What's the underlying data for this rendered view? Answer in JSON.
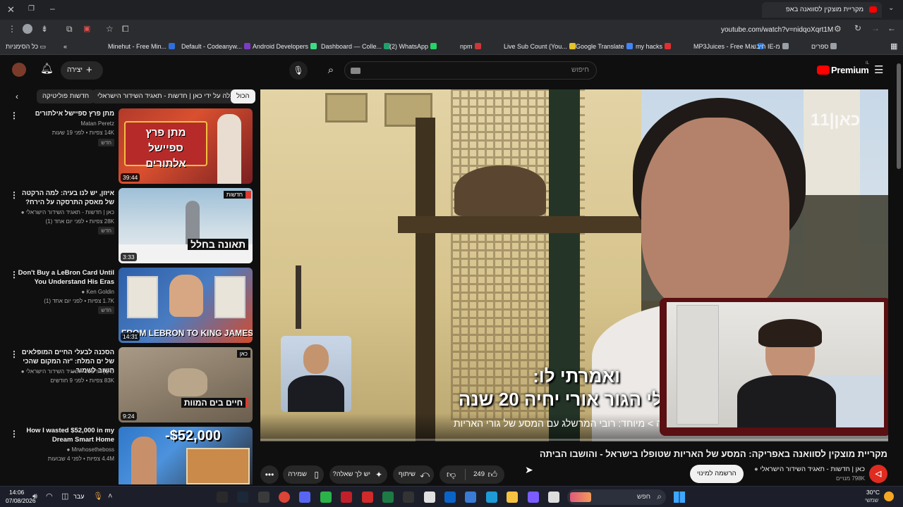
{
  "browser": {
    "tab_title": "מקריית מוצקין לסוואנה באפ",
    "url": "youtube.com/watch?v=nidqoXqrt1M",
    "bookmarks": [
      {
        "label": "Minehut - Free Min...",
        "color": "#2f6fdc"
      },
      {
        "label": "Default - Codeanyw...",
        "color": "#7a3cc4"
      },
      {
        "label": "Android Developers",
        "color": "#3ddc84"
      },
      {
        "label": "Dashboard — Colle...",
        "color": "#22a06b"
      },
      {
        "label": "(2) WhatsApp",
        "color": "#25d366"
      },
      {
        "label": "npm",
        "color": "#cb3837"
      },
      {
        "label": "Live Sub Count (You...",
        "color": "#e5c22b"
      },
      {
        "label": "Google Translate",
        "color": "#4285f4"
      },
      {
        "label": "my hacks",
        "color": "#e03030"
      },
      {
        "label": "MP3Juices - Free M...",
        "color": "#1e6fd9"
      },
      {
        "label": "חיבוא IE-מ",
        "color": "#9aa0a6"
      },
      {
        "label": "ספרים",
        "color": "#9aa0a6"
      }
    ],
    "all_bookmarks": "כל הסימניות"
  },
  "youtube": {
    "logo": "Premium",
    "logo_sup": "IL",
    "search_placeholder": "חיפוש",
    "create_label": "יצירה",
    "chips": [
      "הכול",
      "הועלה על ידי כאן | חדשות - תאגיד השידור הישראלי",
      "חדשות פוליטיקה"
    ]
  },
  "sidebar_videos": [
    {
      "title": "מתן פרץ ספיישל אילתורים",
      "channel": "Matan Peretz",
      "meta": "14K צפיות • לפני 19 שעות",
      "badge": "חדש",
      "duration": "39:44",
      "thumb_text": "מתן פרץ ספיישל אלתורים"
    },
    {
      "title": "איזון, יש לנו בעיה: למה הרקטה של מאסק התרסקה על הירח?",
      "channel": "כאן | חדשות - תאגיד השידור הישראלי",
      "meta": "28K צפיות • לפני יום אחד (1)",
      "badge": "חדש",
      "duration": "3:33",
      "thumb_text": "תאונה בחלל",
      "thumb_tag": "חדשות"
    },
    {
      "title": "Don't Buy a LeBron Card Until You Understand His Eras",
      "channel": "Ken Goldin",
      "meta": "1.7K צפיות • לפני יום אחד (1)",
      "badge": "חדש",
      "duration": "14:31",
      "thumb_text": "FROM LEBRON TO KING JAMES"
    },
    {
      "title": "הסכנה לבעלי החיים המופלאים של ים המלח: \"זה המקום שהכי חשוב לשמור...",
      "channel": "כאן | חדשות - תאגיד השידור הישראלי",
      "meta": "83K צפיות • לפני 9 חודשים",
      "badge": "",
      "duration": "9:24",
      "thumb_text": "חיים בים המוות",
      "thumb_tag": "כאן"
    },
    {
      "title": "How I wasted $52,000 in my Dream Smart Home",
      "channel": "Mrwhosetheboss",
      "meta": "4.4M צפיות • לפני 4 שבועות",
      "badge": "",
      "duration": "",
      "thumb_text": "-$52,000"
    }
  ],
  "player": {
    "watermark": "כאן|11",
    "subtitle_line1": "ואמרתי לו:",
    "subtitle_line2": "לי הגור אורי יחיה 20 שנה",
    "chapter": "ה > מיוחד: רובי המרשלג עם המסע של גורי האריות",
    "progress": 0.0
  },
  "video": {
    "title": "מקריית מוצקין לסוואנה באפריקה: המסע של האריות שטופלו בישראל - והושבו הביתה",
    "channel": "כאן | חדשות - תאגיד השידור הישראלי",
    "subscribers": "798K מנויים",
    "subscribe_label": "הרשמה למינוי",
    "likes": "249",
    "share_label": "שיתוף",
    "ask_label": "יש לך שאלה?",
    "save_label": "שמירה"
  },
  "taskbar": {
    "time": "14:06",
    "date": "07/08/2026",
    "weather_temp": "30°C",
    "weather_desc": "שמשי",
    "search_label": "חפש",
    "lang": "עבר"
  }
}
